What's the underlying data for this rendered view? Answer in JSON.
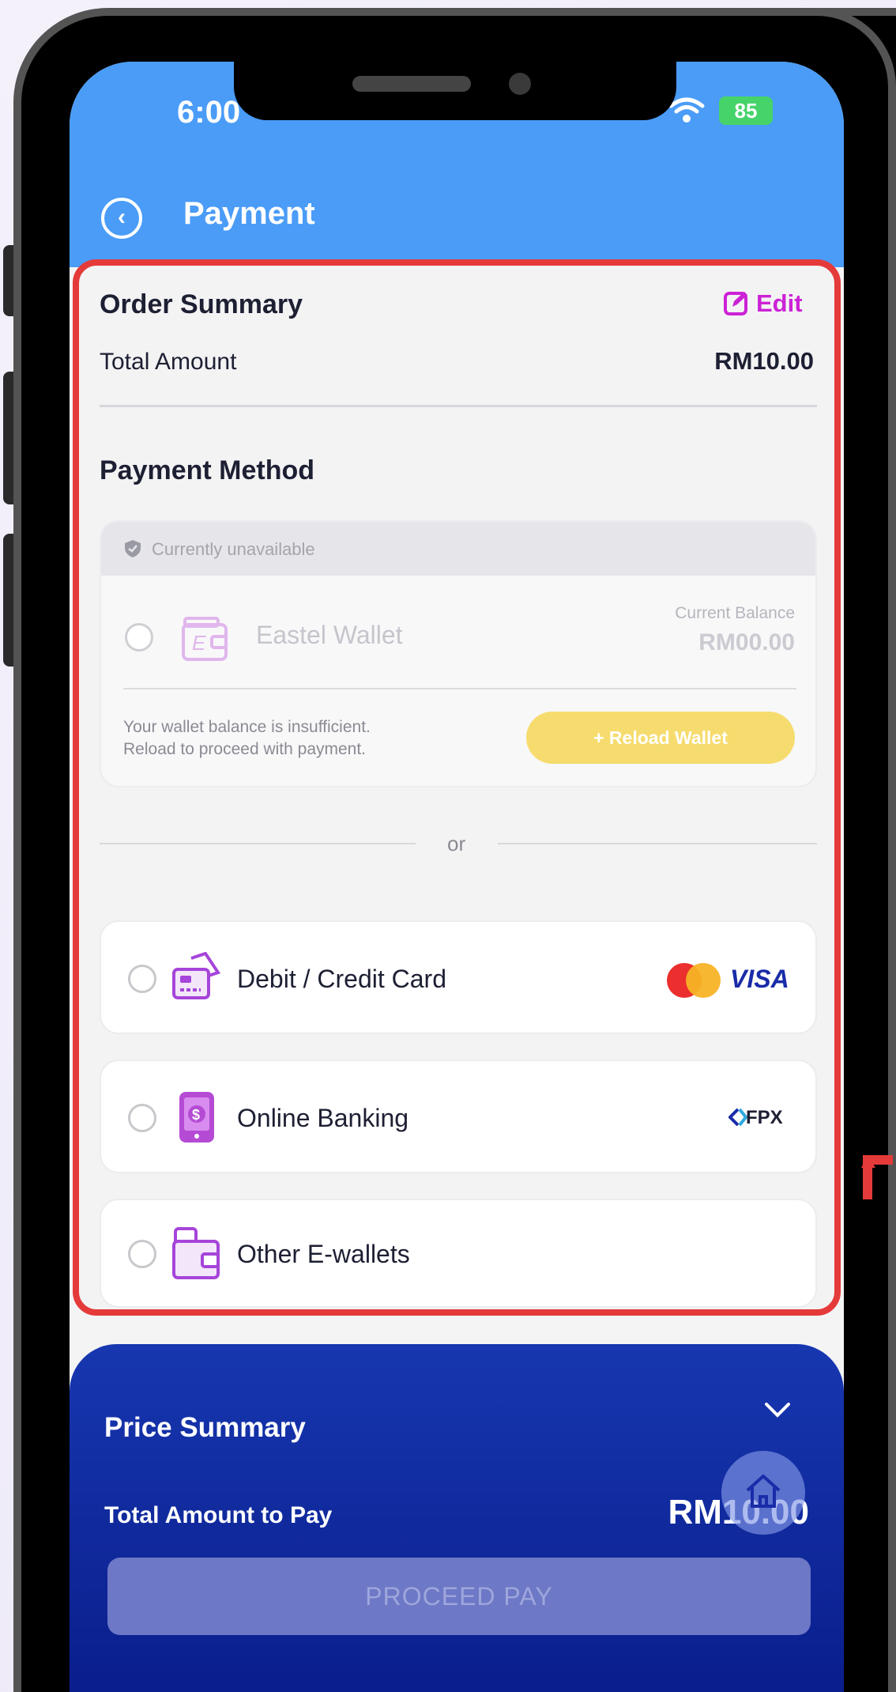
{
  "status_bar": {
    "time": "6:00",
    "signal": "...",
    "battery": "85"
  },
  "header": {
    "title": "Payment"
  },
  "order_summary": {
    "heading": "Order Summary",
    "edit_label": "Edit",
    "total_label": "Total Amount",
    "total_value": "RM10.00"
  },
  "payment_method": {
    "heading": "Payment Method",
    "unavailable_label": "Currently unavailable",
    "wallet": {
      "name": "Eastel Wallet",
      "balance_label": "Current Balance",
      "balance_value": "RM00.00",
      "insufficient_line1": "Your wallet balance is insufficient.",
      "insufficient_line2": "Reload to proceed with payment.",
      "reload_button": "+ Reload Wallet"
    },
    "divider_text": "or",
    "options": [
      {
        "label": "Debit / Credit Card",
        "icon": "card-icon",
        "brand": "VISA"
      },
      {
        "label": "Online Banking",
        "icon": "mobile-banking-icon",
        "brand": "FPX"
      },
      {
        "label": "Other E-wallets",
        "icon": "ewallet-icon"
      }
    ]
  },
  "price_summary": {
    "heading": "Price Summary",
    "total_label": "Total Amount to Pay",
    "total_value": "RM10.00",
    "proceed_button": "PROCEED PAY"
  },
  "colors": {
    "header": "#4a9cf7",
    "highlight": "#e53a3a",
    "edit": "#cc22d6",
    "reload": "#f6dc6e",
    "footer": "#0a1e8c"
  }
}
